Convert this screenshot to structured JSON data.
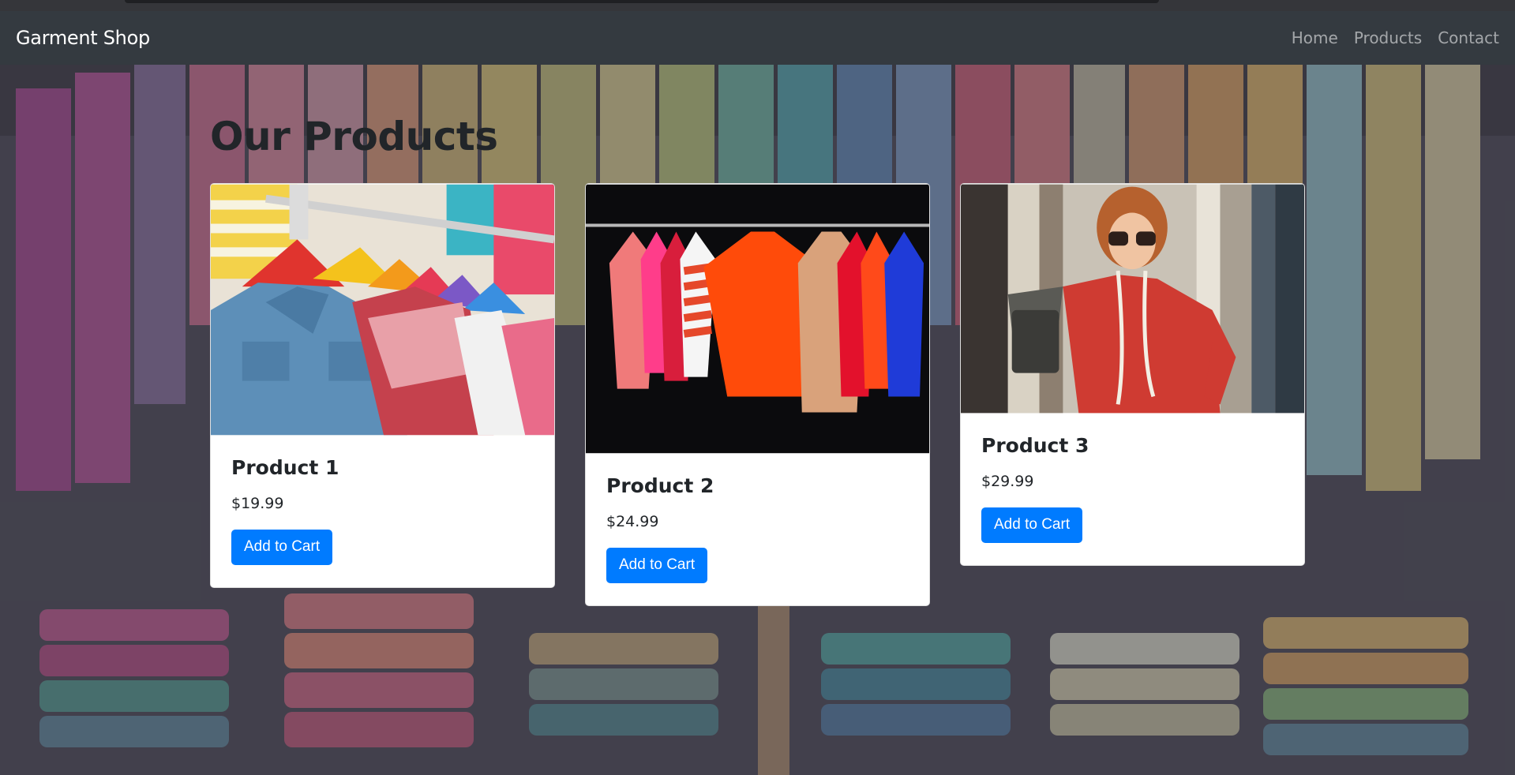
{
  "navbar": {
    "brand": "Garment Shop",
    "links": [
      "Home",
      "Products",
      "Contact"
    ]
  },
  "page": {
    "title": "Our Products"
  },
  "products": [
    {
      "name": "Product 1",
      "price": "$19.99",
      "button": "Add to Cart"
    },
    {
      "name": "Product 2",
      "price": "$24.99",
      "button": "Add to Cart"
    },
    {
      "name": "Product 3",
      "price": "$29.99",
      "button": "Add to Cart"
    }
  ],
  "colors": {
    "navbar": "#343a40",
    "button": "#007bff",
    "text": "#212529"
  }
}
